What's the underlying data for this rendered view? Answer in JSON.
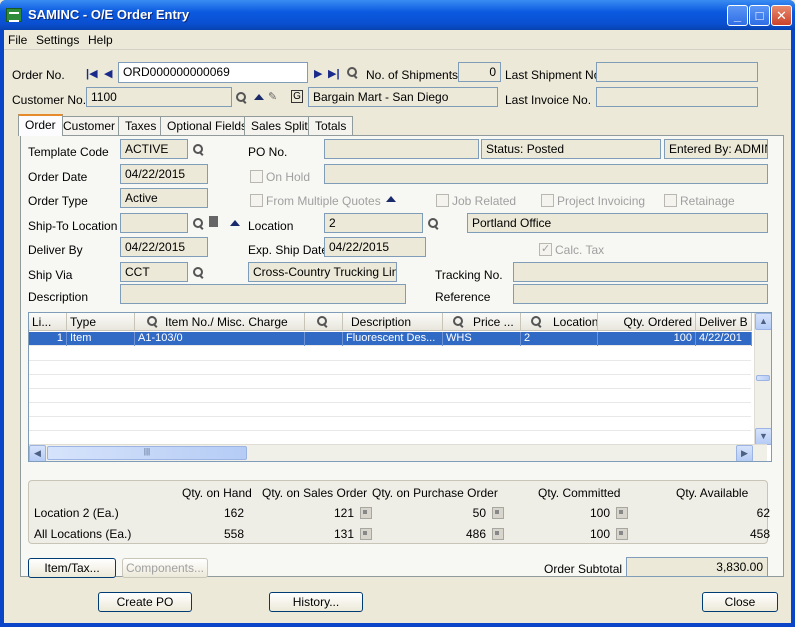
{
  "window": {
    "title": "SAMINC - O/E Order Entry"
  },
  "menu": [
    "File",
    "Settings",
    "Help"
  ],
  "header": {
    "order_no_label": "Order No.",
    "order_no": "ORD000000000069",
    "shipments_label": "No. of Shipments",
    "shipments": "0",
    "last_shipment_label": "Last Shipment No.",
    "last_shipment": "",
    "customer_no_label": "Customer No.",
    "customer_no": "1100",
    "customer_name": "Bargain Mart - San Diego",
    "last_invoice_label": "Last Invoice No.",
    "last_invoice": ""
  },
  "tabs": [
    "Order",
    "Customer",
    "Taxes",
    "Optional Fields",
    "Sales Split",
    "Totals"
  ],
  "order": {
    "template_label": "Template Code",
    "template": "ACTIVE",
    "po_label": "PO No.",
    "po": "",
    "status": "Status: Posted",
    "entered_by": "Entered By: ADMIN",
    "order_date_label": "Order Date",
    "order_date": "04/22/2015",
    "on_hold_label": "On Hold",
    "on_hold_desc": "",
    "order_type_label": "Order Type",
    "order_type": "Active",
    "from_quotes_label": "From Multiple Quotes",
    "job_related_label": "Job Related",
    "project_invoicing_label": "Project Invoicing",
    "retainage_label": "Retainage",
    "shipto_label": "Ship-To Location",
    "shipto": "",
    "location_label": "Location",
    "location": "2",
    "location_desc": "Portland Office",
    "deliver_by_label": "Deliver By",
    "deliver_by": "04/22/2015",
    "exp_ship_label": "Exp. Ship Date",
    "exp_ship": "04/22/2015",
    "calc_tax_label": "Calc. Tax",
    "ship_via_label": "Ship Via",
    "ship_via": "CCT",
    "ship_via_desc": "Cross-Country Trucking Lines",
    "tracking_label": "Tracking No.",
    "tracking": "",
    "description_label": "Description",
    "description": "",
    "reference_label": "Reference",
    "reference": ""
  },
  "grid": {
    "columns": [
      "Li...",
      "Type",
      "Item No./ Misc. Charge",
      "",
      "Description",
      "Price ...",
      "Location",
      "Qty. Ordered",
      "Deliver B"
    ],
    "rows": [
      [
        "1",
        "Item",
        "A1-103/0",
        "",
        "Fluorescent Des...",
        "WHS",
        "2",
        "100",
        "4/22/201"
      ]
    ]
  },
  "qty": {
    "headers": [
      "Qty. on Hand",
      "Qty. on Sales Order",
      "Qty. on Purchase Order",
      "Qty. Committed",
      "Qty. Available"
    ],
    "rows": [
      {
        "label": "Location  2 (Ea.)",
        "values": [
          "162",
          "121",
          "50",
          "100",
          "62"
        ]
      },
      {
        "label": "All Locations (Ea.)",
        "values": [
          "558",
          "131",
          "486",
          "100",
          "458"
        ]
      }
    ]
  },
  "footer": {
    "item_tax": "Item/Tax...",
    "components": "Components...",
    "subtotal_label": "Order Subtotal",
    "subtotal": "3,830.00",
    "create_po": "Create PO",
    "history": "History...",
    "close": "Close"
  }
}
